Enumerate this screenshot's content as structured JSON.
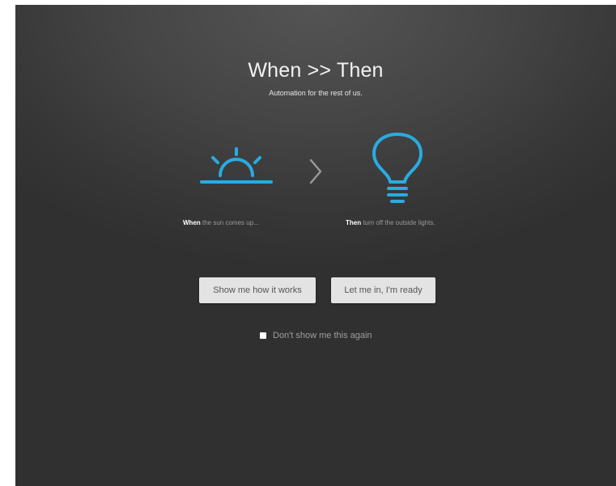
{
  "header": {
    "title": "When >> Then",
    "subtitle": "Automation for the rest of us."
  },
  "example": {
    "when_keyword": "When",
    "when_text": " the sun comes up...",
    "then_keyword": "Then",
    "then_text": " turn off the outside lights."
  },
  "icons": {
    "trigger": "sunrise-icon",
    "arrow": "chevron-right-icon",
    "action": "lightbulb-icon",
    "accent_color": "#29abe2"
  },
  "actions": {
    "how_label": "Show me how it works",
    "ready_label": "Let me in, I'm ready"
  },
  "options": {
    "dont_show_label": "Don't show me this again",
    "dont_show_checked": false
  }
}
